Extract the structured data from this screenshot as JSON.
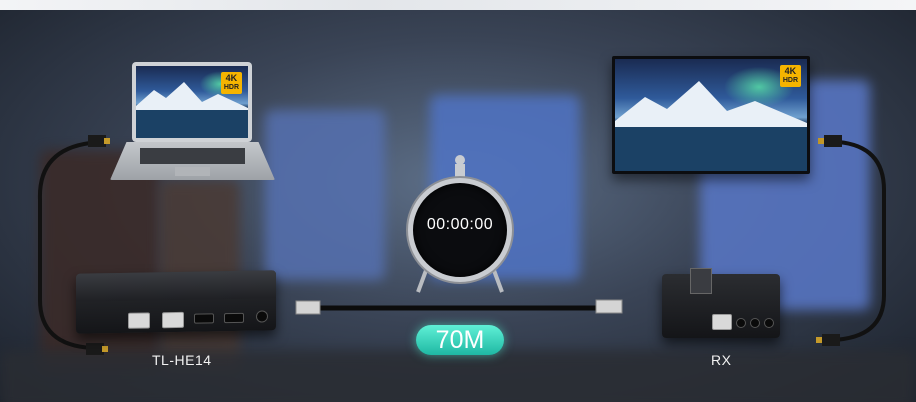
{
  "timer": {
    "display": "00:00:00"
  },
  "cable": {
    "distance": "70M"
  },
  "transmitter": {
    "model": "TL-HE14"
  },
  "receiver": {
    "model": "RX"
  },
  "badges": {
    "resolution": "4K",
    "hdr": "HDR"
  },
  "colors": {
    "distance_pill": "#2cc9b2",
    "badge": "#f5b400"
  }
}
